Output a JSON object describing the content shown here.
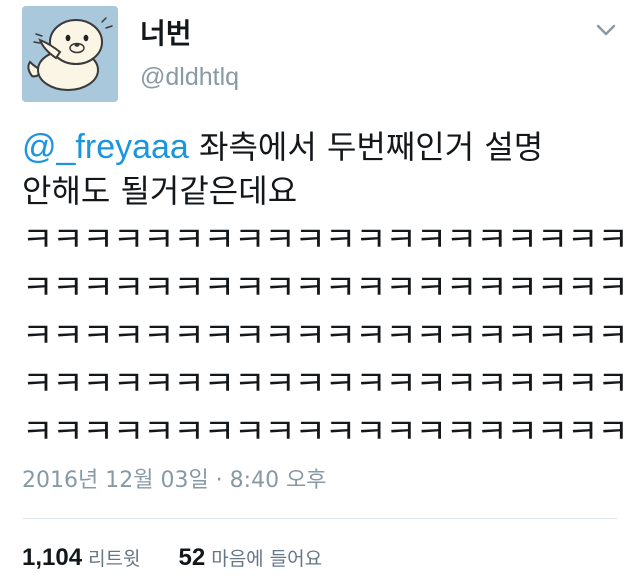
{
  "user": {
    "display_name": "너번",
    "handle": "@dldhtlq",
    "avatar": "seal-cartoon-avatar"
  },
  "icons": {
    "menu": "chevron-down-icon"
  },
  "tweet": {
    "mention": "@_freyaaa",
    "text_line1": " 좌측에서 두번째인거 설명",
    "text_line2": "안해도 될거같은데요",
    "laugh_lines": [
      "ㅋㅋㅋㅋㅋㅋㅋㅋㅋㅋㅋㅋㅋㅋㅋㅋㅋㅋㅋㅋ",
      "ㅋㅋㅋㅋㅋㅋㅋㅋㅋㅋㅋㅋㅋㅋㅋㅋㅋㅋㅋㅋ",
      "ㅋㅋㅋㅋㅋㅋㅋㅋㅋㅋㅋㅋㅋㅋㅋㅋㅋㅋㅋㅋ",
      "ㅋㅋㅋㅋㅋㅋㅋㅋㅋㅋㅋㅋㅋㅋㅋㅋㅋㅋㅋㅋ",
      "ㅋㅋㅋㅋㅋㅋㅋㅋㅋㅋㅋㅋㅋㅋㅋㅋㅋㅋㅋㅋ"
    ],
    "timestamp": "2016년 12월 03일 · 8:40 오후"
  },
  "stats": {
    "retweets_count": "1,104",
    "retweets_label": "리트윗",
    "likes_count": "52",
    "likes_label": "마음에 들어요"
  },
  "colors": {
    "link": "#1b95e0",
    "muted": "#8899a6",
    "avatar_bg": "#a9c8dc"
  }
}
